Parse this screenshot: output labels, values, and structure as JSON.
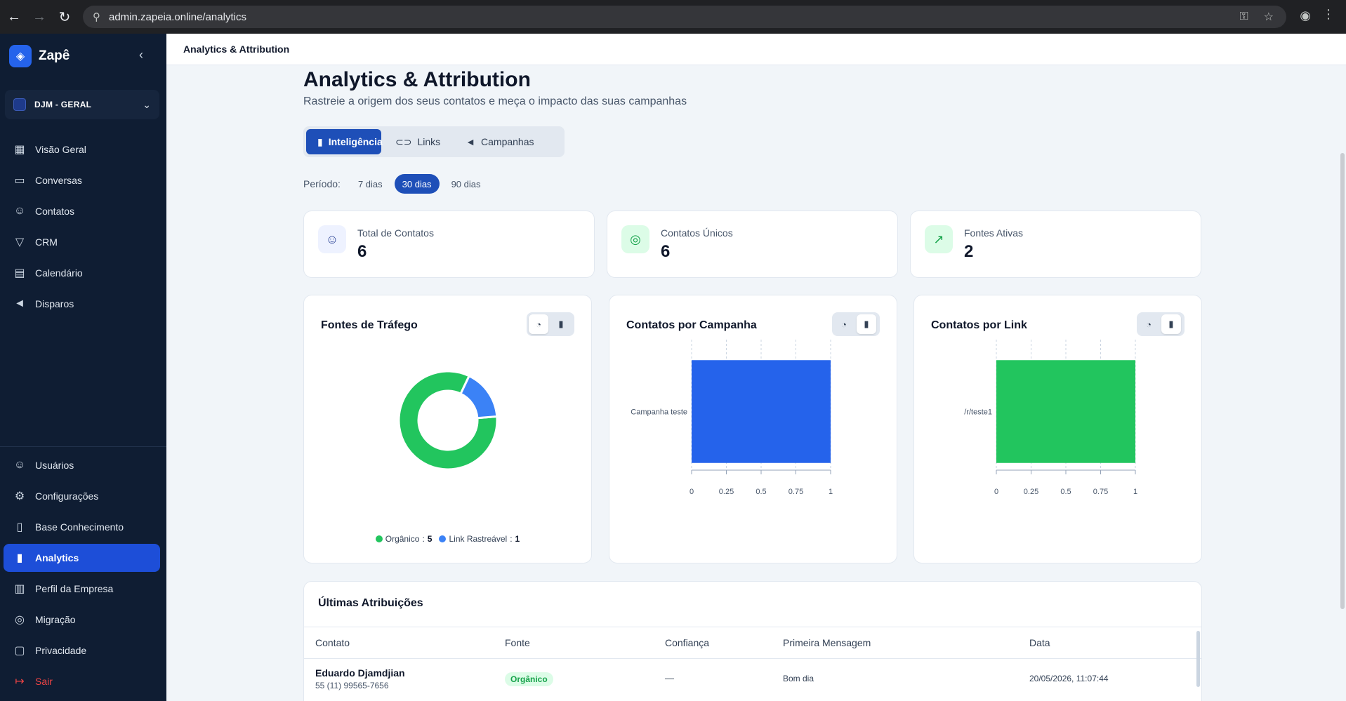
{
  "browser": {
    "url": "admin.zapeia.online/analytics"
  },
  "sidebar": {
    "brand": "Zapê",
    "org": "DJM - GERAL",
    "items_top": [
      {
        "label": "Visão Geral",
        "icon": "grid-icon",
        "glyph": "▦"
      },
      {
        "label": "Conversas",
        "icon": "message-square-icon",
        "glyph": "▭"
      },
      {
        "label": "Contatos",
        "icon": "users-icon",
        "glyph": "☺"
      },
      {
        "label": "CRM",
        "icon": "filter-icon",
        "glyph": "▽"
      },
      {
        "label": "Calendário",
        "icon": "calendar-icon",
        "glyph": "▤"
      },
      {
        "label": "Disparos",
        "icon": "megaphone-icon",
        "glyph": "◄"
      }
    ],
    "items_bottom": [
      {
        "label": "Usuários",
        "icon": "users-icon",
        "glyph": "☺"
      },
      {
        "label": "Configurações",
        "icon": "gear-icon",
        "glyph": "⚙"
      },
      {
        "label": "Base Conhecimento",
        "icon": "book-icon",
        "glyph": "▯"
      },
      {
        "label": "Analytics",
        "icon": "bar-chart-icon",
        "glyph": "▮",
        "active": true
      },
      {
        "label": "Perfil da Empresa",
        "icon": "building-icon",
        "glyph": "▥"
      },
      {
        "label": "Migração",
        "icon": "database-icon",
        "glyph": "◎"
      },
      {
        "label": "Privacidade",
        "icon": "file-icon",
        "glyph": "▢"
      },
      {
        "label": "Sair",
        "icon": "logout-icon",
        "glyph": "↦",
        "logout": true
      }
    ]
  },
  "header": {
    "breadcrumb": "Analytics & Attribution"
  },
  "page": {
    "title": "Analytics & Attribution",
    "subtitle": "Rastreie a origem dos seus contatos e meça o impacto das suas campanhas"
  },
  "tabs": [
    {
      "label": "Inteligência",
      "icon": "bar-chart-icon",
      "glyph": "▮",
      "active": true
    },
    {
      "label": "Links",
      "icon": "link-icon",
      "glyph": "⊂⊃"
    },
    {
      "label": "Campanhas",
      "icon": "megaphone-icon",
      "glyph": "◄"
    }
  ],
  "period": {
    "label": "Período:",
    "options": [
      "7 dias",
      "30 dias",
      "90 dias"
    ],
    "selected": "30 dias"
  },
  "stats": [
    {
      "label": "Total de Contatos",
      "value": "6",
      "icon": "users-icon",
      "glyph": "☺",
      "bg": "#eef2ff",
      "color": "#334a9a"
    },
    {
      "label": "Contatos Únicos",
      "value": "6",
      "icon": "target-icon",
      "glyph": "◎",
      "bg": "#dcfce7",
      "color": "#16a34a"
    },
    {
      "label": "Fontes Ativas",
      "value": "2",
      "icon": "trending-up-icon",
      "glyph": "↗",
      "bg": "#dcfce7",
      "color": "#16a34a"
    }
  ],
  "colors": {
    "green": "#22c55e",
    "blue": "#3b82f6",
    "bar_blue": "#2563eb",
    "accent": "#1e4fb8"
  },
  "chart_data": [
    {
      "type": "pie",
      "title": "Fontes de Tráfego",
      "categories": [
        "Orgânico",
        "Link Rastreável"
      ],
      "values": [
        5,
        1
      ]
    },
    {
      "type": "bar",
      "title": "Contatos por Campanha",
      "orientation": "horizontal",
      "categories": [
        "Campanha teste"
      ],
      "values": [
        1
      ],
      "xlim": [
        0,
        1
      ],
      "xticks": [
        "0",
        "0.25",
        "0.5",
        "0.75",
        "1"
      ],
      "grid": true
    },
    {
      "type": "bar",
      "title": "Contatos por Link",
      "orientation": "horizontal",
      "categories": [
        "/r/teste1"
      ],
      "values": [
        1
      ],
      "xlim": [
        0,
        1
      ],
      "xticks": [
        "0",
        "0.25",
        "0.5",
        "0.75",
        "1"
      ],
      "grid": true
    }
  ],
  "table": {
    "title": "Últimas Atribuições",
    "columns": [
      "Contato",
      "Fonte",
      "Confiança",
      "Primeira Mensagem",
      "Data"
    ],
    "rows": [
      {
        "name": "Eduardo Djamdjian",
        "phone": "55 (11) 99565-7656",
        "source": "Orgânico",
        "confidence": "—",
        "first_message": "Bom dia",
        "date": "20/05/2026, 11:07:44"
      }
    ]
  }
}
